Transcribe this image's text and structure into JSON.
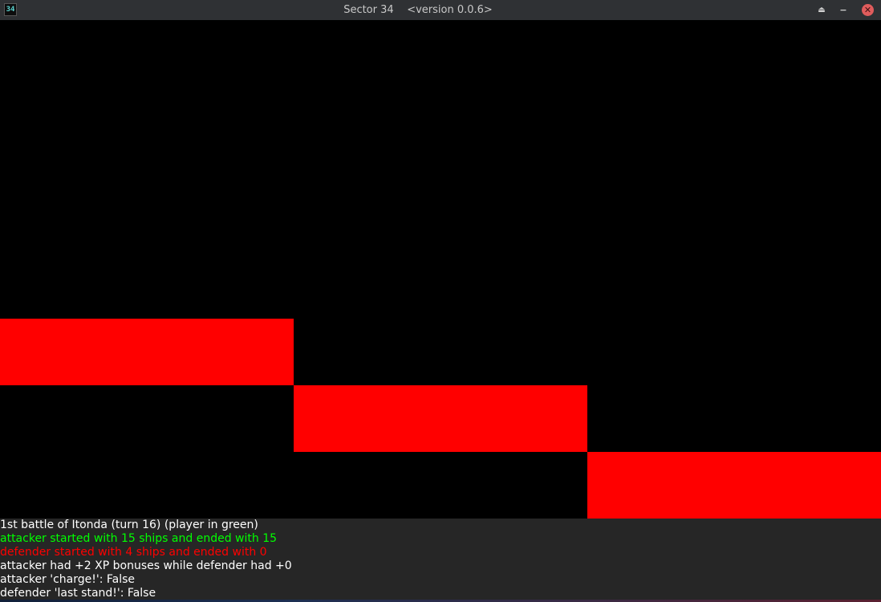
{
  "window": {
    "title": "Sector 34",
    "version": "<version 0.0.6>",
    "app_icon_text": "34"
  },
  "controls": {
    "eject_icon": "eject-icon",
    "minimize_icon": "minimize-icon",
    "close_icon": "close-icon"
  },
  "colors": {
    "attacker": "#00ff00",
    "defender": "#ff0000",
    "neutral": "#ffffff",
    "bar": "#ff0000"
  },
  "chart_data": {
    "type": "bar",
    "note_free": true,
    "series": [
      {
        "color": "#ff0000",
        "values": [
          3,
          2,
          1
        ]
      }
    ],
    "categories": [
      "",
      "",
      ""
    ]
  },
  "log": {
    "lines": [
      {
        "text": "1st battle of Itonda (turn 16) (player in green)",
        "color": "#ffffff"
      },
      {
        "text": "attacker started with 15 ships and ended with 15",
        "color": "#00ff00"
      },
      {
        "text": "defender started with 4 ships and ended with 0",
        "color": "#ff0000"
      },
      {
        "text": "attacker had +2 XP bonuses while defender had +0",
        "color": "#ffffff"
      },
      {
        "text": "attacker 'charge!': False",
        "color": "#ffffff"
      },
      {
        "text": "defender 'last stand!': False",
        "color": "#ffffff"
      }
    ]
  }
}
